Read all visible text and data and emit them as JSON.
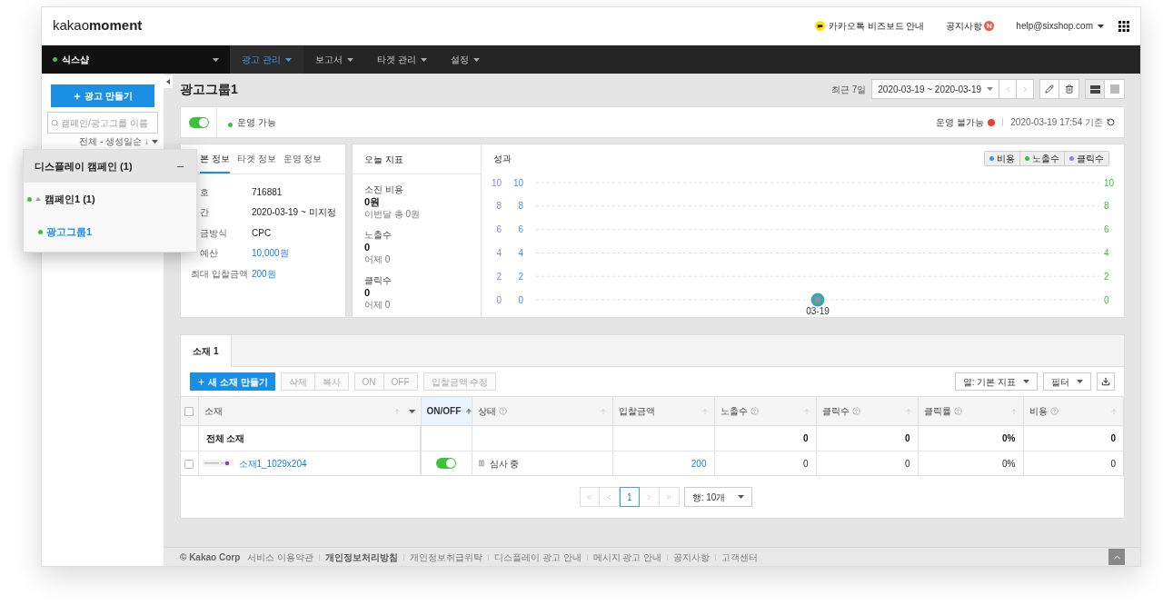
{
  "header": {
    "logo_light": "kakao",
    "logo_bold": "moment",
    "bizboard": "카카오톡 비즈보드 안내",
    "notice": {
      "label": "공지사항",
      "badge": "N"
    },
    "account": "help@sixshop.com"
  },
  "nav": {
    "account": {
      "name": "식스샵",
      "active": true
    },
    "items": [
      {
        "label": "광고 관리",
        "selected": true
      },
      {
        "label": "보고서",
        "selected": false
      },
      {
        "label": "타겟 관리",
        "selected": false
      },
      {
        "label": "설정",
        "selected": false
      }
    ]
  },
  "sidebar": {
    "create_button": "광고 만들기",
    "search": {
      "placeholder": "캠페인/광고그룹 이름"
    },
    "sort": "전체 - 생성일순 ↓"
  },
  "campaign_panel": {
    "title": "디스플레이 캠페인 (1)",
    "tree": [
      {
        "label": "캠페인1 (1)",
        "active": true,
        "expanded": true,
        "selected": false,
        "children": [
          {
            "label": "광고그룹1",
            "active": true,
            "selected": true
          }
        ]
      }
    ]
  },
  "page": {
    "title": "광고그룹1",
    "period": "최근 7일",
    "date_range": "2020-03-19 ~ 2020-03-19",
    "views": [
      {
        "kind": "rows",
        "selected": true
      },
      {
        "kind": "grid",
        "selected": false
      }
    ]
  },
  "status": {
    "on": true,
    "state": "운영 가능",
    "alert": "운영 불가능",
    "updated": "2020-03-19 17:54 기준"
  },
  "info": {
    "tabs": [
      {
        "label": "본 정보",
        "selected": true,
        "clipped": true
      },
      {
        "label": "타겟 정보",
        "selected": false,
        "clipped": false
      },
      {
        "label": "운영 정보",
        "selected": false,
        "clipped": false
      }
    ],
    "rows": [
      {
        "label": "호",
        "value": "716881",
        "clipped": true,
        "link": false
      },
      {
        "label": "간",
        "value": "2020-03-19 ~ 미지정",
        "clipped": true,
        "link": false
      },
      {
        "label": "금방식",
        "value": "CPC",
        "clipped": true,
        "link": false
      },
      {
        "label": "예산",
        "value": "10,000원",
        "clipped": true,
        "link": true
      },
      {
        "label": "최대 입찰금액",
        "value": "200원",
        "clipped": false,
        "link": true
      }
    ]
  },
  "today": {
    "title": "오늘 지표",
    "metrics": [
      {
        "label": "소진 비용",
        "value": "0원",
        "sub": "이번달 총 0원"
      },
      {
        "label": "노출수",
        "value": "0",
        "sub": "어제 0"
      },
      {
        "label": "클릭수",
        "value": "0",
        "sub": "어제 0"
      }
    ]
  },
  "performance": {
    "title": "성과",
    "inner_left_axis_ticks": [
      "10",
      "8",
      "6",
      "4",
      "2",
      "0"
    ],
    "right_axis_ticks": [
      "10",
      "8",
      "6",
      "4",
      "2",
      "0"
    ],
    "chart_data": {
      "type": "line",
      "categories": [
        "03-19"
      ],
      "ylim": [
        0,
        10
      ],
      "yticks": [
        0,
        2,
        4,
        6,
        8,
        10
      ],
      "grid": true,
      "series": [
        {
          "name": "비용",
          "color": "#4a90e2",
          "marker": true,
          "values": [
            0
          ]
        },
        {
          "name": "노출수",
          "color": "#3cc13b",
          "marker": true,
          "values": [
            0
          ]
        },
        {
          "name": "클릭수",
          "color": "#8f7ef5",
          "marker": true,
          "values": [
            0
          ]
        }
      ]
    }
  },
  "creatives": {
    "tabs": [
      {
        "label": "소재 1",
        "selected": true
      }
    ],
    "toolbar": {
      "create": "새 소재 만들기",
      "groups": [
        [
          {
            "label": "삭제",
            "disabled": true
          },
          {
            "label": "복사",
            "disabled": true
          }
        ],
        [
          {
            "label": "ON",
            "disabled": true
          },
          {
            "label": "OFF",
            "disabled": true
          }
        ],
        [
          {
            "label": "입찰금액 수정",
            "disabled": true
          }
        ]
      ],
      "columns_select": "열: 기본 지표",
      "filter": "필터"
    },
    "all_checked": false,
    "columns": [
      {
        "label": "소재",
        "help": false,
        "sorted": false
      },
      {
        "label": "ON/OFF",
        "help": false,
        "sorted": true
      },
      {
        "label": "상태",
        "help": true,
        "sorted": false
      },
      {
        "label": "입찰금액",
        "help": false,
        "sorted": false
      },
      {
        "label": "노출수",
        "help": true,
        "sorted": false
      },
      {
        "label": "클릭수",
        "help": true,
        "sorted": false
      },
      {
        "label": "클릭률",
        "help": true,
        "sorted": false
      },
      {
        "label": "비용",
        "help": true,
        "sorted": false
      }
    ],
    "rows": [
      {
        "kind": "total",
        "name": "전체 소재",
        "impressions": "0",
        "clicks": "0",
        "ctr": "0%",
        "cost": "0"
      },
      {
        "kind": "item",
        "checked": false,
        "name": "소재1_1029x204",
        "on": true,
        "status": "심사 중",
        "bid": "200",
        "impressions": "0",
        "clicks": "0",
        "ctr": "0%",
        "cost": "0"
      }
    ],
    "pagination": {
      "pages": [
        {
          "label": "1",
          "selected": true
        }
      ],
      "rows_select": "행: 10개"
    }
  },
  "footer": {
    "copyright": "© Kakao Corp",
    "links": [
      {
        "label": "서비스 이용약관",
        "bold": false
      },
      {
        "label": "개인정보처리방침",
        "bold": true
      },
      {
        "label": "개인정보취급위탁",
        "bold": false
      },
      {
        "label": "디스플레이 광고 안내",
        "bold": false
      },
      {
        "label": "메시지 광고 안내",
        "bold": false
      },
      {
        "label": "공지사항",
        "bold": false
      },
      {
        "label": "고객센터",
        "bold": false
      }
    ]
  }
}
